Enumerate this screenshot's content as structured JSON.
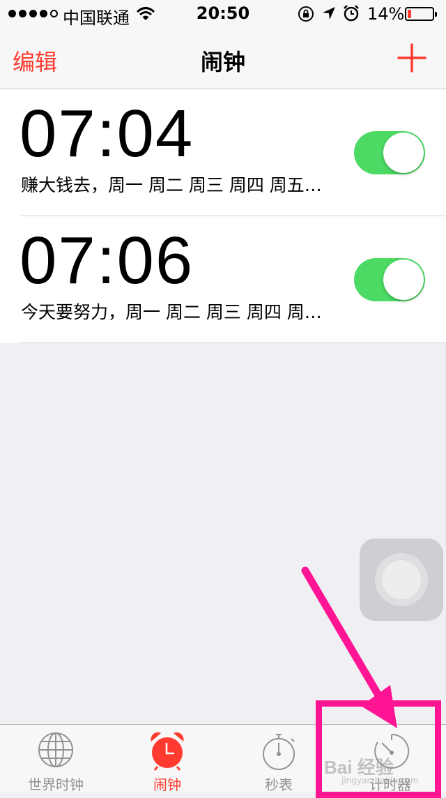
{
  "status_bar": {
    "carrier": "中国联通",
    "time": "20:50",
    "battery_percent": "14%",
    "battery_level": 0.14,
    "battery_color": "#ff3b30"
  },
  "nav": {
    "edit_label": "编辑",
    "title": "闹钟",
    "add_icon": "plus-icon"
  },
  "alarms": [
    {
      "time": "07:04",
      "description": "赚大钱去，周一 周二 周三 周四 周五…",
      "enabled": true
    },
    {
      "time": "07:06",
      "description": "今天要努力，周一 周二 周三 周四 周…",
      "enabled": true
    }
  ],
  "tabs": [
    {
      "label": "世界时钟",
      "icon": "globe-icon",
      "active": false
    },
    {
      "label": "闹钟",
      "icon": "alarm-clock-icon",
      "active": true
    },
    {
      "label": "秒表",
      "icon": "stopwatch-icon",
      "active": false
    },
    {
      "label": "计时器",
      "icon": "timer-icon",
      "active": false
    }
  ],
  "colors": {
    "accent": "#ff3b30",
    "toggle_on": "#4cd964",
    "annotation": "#ff1493"
  },
  "watermark": {
    "text": "Bai 经验",
    "sub": "jingyan.baidu.com"
  }
}
